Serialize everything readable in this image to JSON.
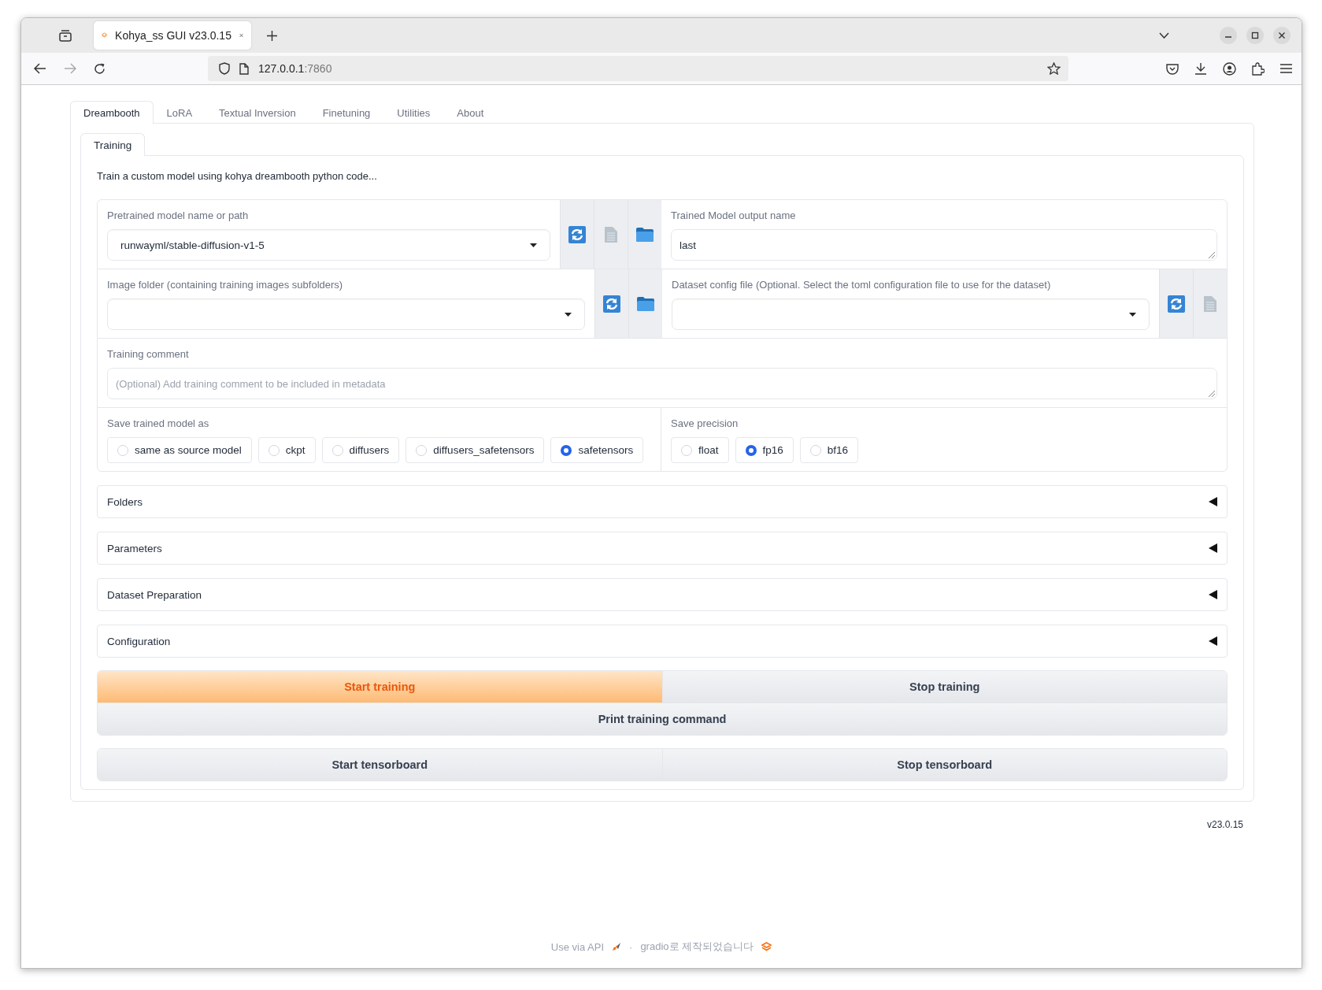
{
  "browser": {
    "tab_title": "Kohya_ss GUI v23.0.15",
    "url_host": "127.0.0.1",
    "url_port": ":7860"
  },
  "main_tabs": [
    {
      "label": "Dreambooth",
      "selected": true
    },
    {
      "label": "LoRA",
      "selected": false
    },
    {
      "label": "Textual Inversion",
      "selected": false
    },
    {
      "label": "Finetuning",
      "selected": false
    },
    {
      "label": "Utilities",
      "selected": false
    },
    {
      "label": "About",
      "selected": false
    }
  ],
  "sub_tabs": [
    {
      "label": "Training",
      "selected": true
    }
  ],
  "description": "Train a custom model using kohya dreambooth python code...",
  "pretrained_model": {
    "label": "Pretrained model name or path",
    "value": "runwayml/stable-diffusion-v1-5"
  },
  "output_name": {
    "label": "Trained Model output name",
    "value": "last"
  },
  "image_folder": {
    "label": "Image folder (containing training images subfolders)"
  },
  "dataset_config": {
    "label": "Dataset config file (Optional. Select the toml configuration file to use for the dataset)"
  },
  "training_comment": {
    "label": "Training comment",
    "placeholder": "(Optional) Add training comment to be included in metadata"
  },
  "save_model_as": {
    "label": "Save trained model as",
    "options": [
      {
        "label": "same as source model",
        "selected": false
      },
      {
        "label": "ckpt",
        "selected": false
      },
      {
        "label": "diffusers",
        "selected": false
      },
      {
        "label": "diffusers_safetensors",
        "selected": false
      },
      {
        "label": "safetensors",
        "selected": true
      }
    ]
  },
  "save_precision": {
    "label": "Save precision",
    "options": [
      {
        "label": "float",
        "selected": false
      },
      {
        "label": "fp16",
        "selected": true
      },
      {
        "label": "bf16",
        "selected": false
      }
    ]
  },
  "accordions": [
    {
      "label": "Folders",
      "expanded": false
    },
    {
      "label": "Parameters",
      "expanded": false
    },
    {
      "label": "Dataset Preparation",
      "expanded": false
    },
    {
      "label": "Configuration",
      "expanded": false
    }
  ],
  "button_groups": [
    {
      "rows": [
        [
          {
            "label": "Start training",
            "kind": "primary"
          },
          {
            "label": "Stop training",
            "kind": "secondary"
          }
        ],
        [
          {
            "label": "Print training command",
            "kind": "secondary"
          }
        ]
      ]
    },
    {
      "rows": [
        [
          {
            "label": "Start tensorboard",
            "kind": "secondary"
          },
          {
            "label": "Stop tensorboard",
            "kind": "secondary"
          }
        ]
      ]
    }
  ],
  "version": "v23.0.15",
  "footer": {
    "api_link": "Use via API",
    "separator": "·",
    "built_with": "gradio로 제작되었습니다"
  }
}
